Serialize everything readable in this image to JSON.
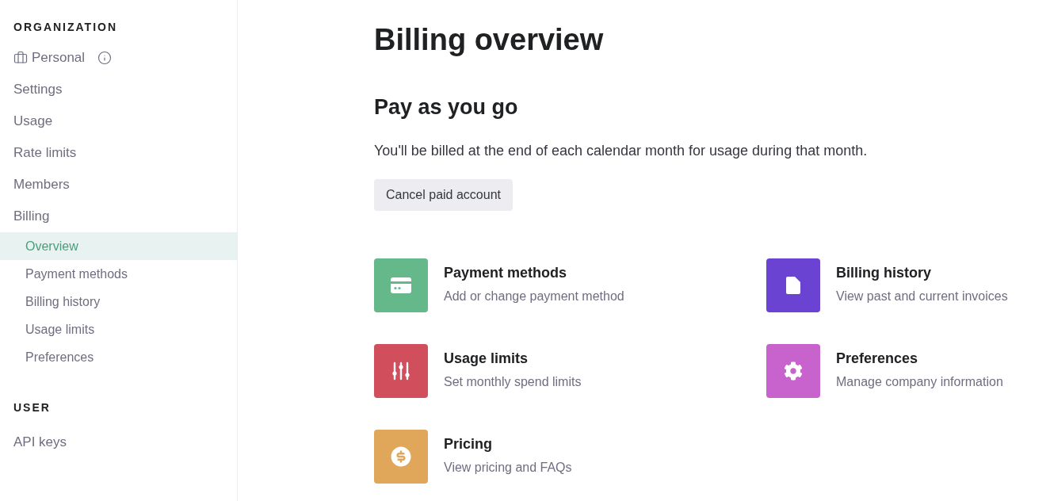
{
  "sidebar": {
    "sections": [
      {
        "heading": "ORGANIZATION",
        "organization": {
          "name": "Personal"
        },
        "items": [
          {
            "label": "Settings",
            "selected": false
          },
          {
            "label": "Usage",
            "selected": false
          },
          {
            "label": "Rate limits",
            "selected": false
          },
          {
            "label": "Members",
            "selected": false
          },
          {
            "label": "Billing",
            "selected": false,
            "children": [
              {
                "label": "Overview",
                "selected": true
              },
              {
                "label": "Payment methods",
                "selected": false
              },
              {
                "label": "Billing history",
                "selected": false
              },
              {
                "label": "Usage limits",
                "selected": false
              },
              {
                "label": "Preferences",
                "selected": false
              }
            ]
          }
        ]
      },
      {
        "heading": "USER",
        "items": [
          {
            "label": "API keys",
            "selected": false
          }
        ]
      }
    ]
  },
  "main": {
    "title": "Billing overview",
    "plan": {
      "heading": "Pay as you go",
      "description": "You'll be billed at the end of each calendar month for usage during that month.",
      "button": "Cancel paid account"
    },
    "cards": [
      {
        "title": "Payment methods",
        "description": "Add or change payment method",
        "color": "#64b88a"
      },
      {
        "title": "Billing history",
        "description": "View past and current invoices",
        "color": "#6a43d2"
      },
      {
        "title": "Usage limits",
        "description": "Set monthly spend limits",
        "color": "#d14f5c"
      },
      {
        "title": "Preferences",
        "description": "Manage company information",
        "color": "#c862cd"
      },
      {
        "title": "Pricing",
        "description": "View pricing and FAQs",
        "color": "#e0a65a"
      }
    ]
  }
}
